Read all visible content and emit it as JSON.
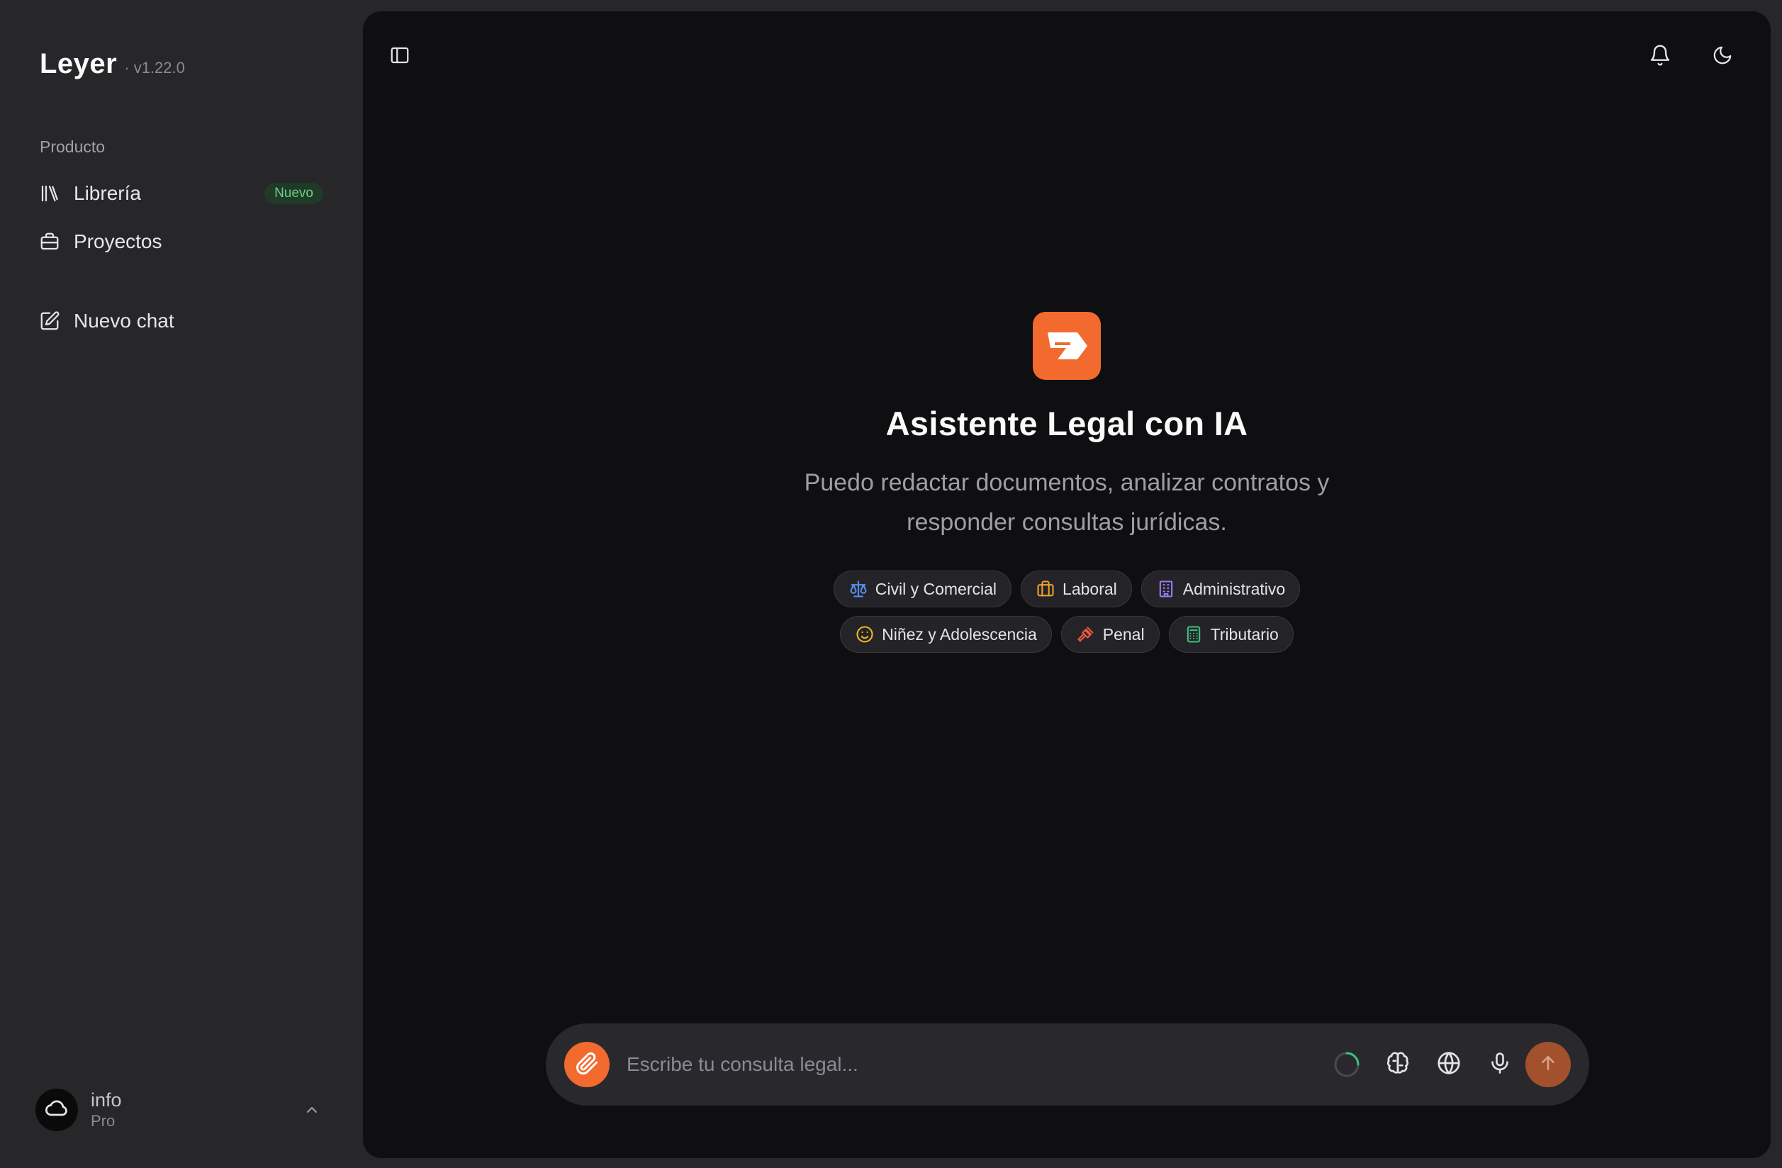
{
  "sidebar": {
    "brand": {
      "name": "Leyer",
      "version": "· v1.22.0"
    },
    "section_label": "Producto",
    "items": [
      {
        "label": "Librería",
        "icon": "library-icon",
        "badge": "Nuevo"
      },
      {
        "label": "Proyectos",
        "icon": "briefcase-icon"
      },
      {
        "label": "Nuevo chat",
        "icon": "edit-icon"
      }
    ],
    "user": {
      "name": "info",
      "plan": "Pro",
      "avatar_icon": "cloud-icon"
    }
  },
  "main": {
    "top_icons": [
      "sidebar-toggle-icon",
      "bell-icon",
      "moon-icon"
    ],
    "hero": {
      "logo_icon": "leyer-logo",
      "title": "Asistente Legal con IA",
      "subtitle_line1": "Puedo redactar documentos, analizar contratos y",
      "subtitle_line2": "responder consultas jurídicas."
    },
    "chips": [
      {
        "label": "Civil y Comercial",
        "icon": "scale-icon",
        "color": "#5b8def"
      },
      {
        "label": "Laboral",
        "icon": "briefcase-icon",
        "color": "#f0a030"
      },
      {
        "label": "Administrativo",
        "icon": "building-icon",
        "color": "#9b7cf0"
      },
      {
        "label": "Niñez y Adolescencia",
        "icon": "smile-icon",
        "color": "#f0b429"
      },
      {
        "label": "Penal",
        "icon": "gavel-icon",
        "color": "#ef5a3c"
      },
      {
        "label": "Tributario",
        "icon": "calculator-icon",
        "color": "#3fbf7f"
      }
    ],
    "composer": {
      "placeholder": "Escribe tu consulta legal...",
      "icons": [
        "paperclip-icon",
        "loading-spinner-icon",
        "brain-icon",
        "globe-icon",
        "mic-icon",
        "arrow-up-icon"
      ]
    }
  },
  "colors": {
    "accent": "#f26a2d",
    "send_button": "#a3512c",
    "badge_bg": "#1f3a26",
    "badge_text": "#6fcf86",
    "panel_bg": "#0f0e11",
    "sidebar_bg": "#27272a"
  }
}
